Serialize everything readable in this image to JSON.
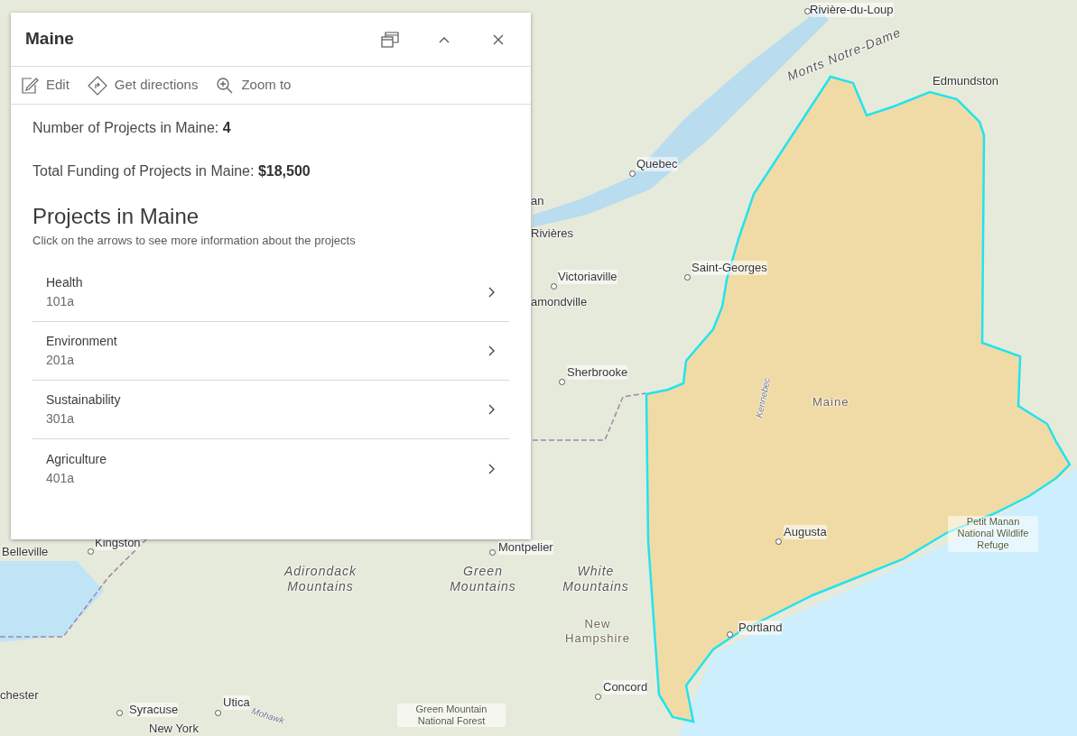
{
  "popup": {
    "title": "Maine",
    "actions": [
      {
        "kind": "edit",
        "label": "Edit"
      },
      {
        "kind": "directions",
        "label": "Get directions"
      },
      {
        "kind": "zoom",
        "label": "Zoom to"
      }
    ],
    "fields": [
      "Number of Projects in Maine: **4**",
      "Total Funding of Projects in Maine: **$18,500**"
    ],
    "heading": "Projects in Maine",
    "description": "Click on the arrows to see more information about the projects",
    "projects": [
      {
        "name": "Health",
        "code": "101a"
      },
      {
        "name": "Environment",
        "code": "201a"
      },
      {
        "name": "Sustainability",
        "code": "301a"
      },
      {
        "name": "Agriculture",
        "code": "401a"
      }
    ]
  },
  "map": {
    "labels": [
      {
        "text": "Rivière-du-Loup",
        "kind": "city"
      },
      {
        "text": "Monts Notre-Dame",
        "kind": "range"
      },
      {
        "text": "Edmundston",
        "kind": "place"
      },
      {
        "text": "Quebec",
        "kind": "city"
      },
      {
        "text": "an",
        "kind": "place"
      },
      {
        "text": "Rivières",
        "kind": "place"
      },
      {
        "text": "Victoriaville",
        "kind": "city"
      },
      {
        "text": "amondville",
        "kind": "place"
      },
      {
        "text": "Saint-Georges",
        "kind": "city"
      },
      {
        "text": "Sherbrooke",
        "kind": "city"
      },
      {
        "text": "Maine",
        "kind": "state"
      },
      {
        "text": "Kennebec",
        "kind": "river"
      },
      {
        "text": "Augusta",
        "kind": "city"
      },
      {
        "text": "Petit Manan National Wildlife Refuge",
        "kind": "park"
      },
      {
        "text": "Portland",
        "kind": "city"
      },
      {
        "text": "Belleville",
        "kind": "place"
      },
      {
        "text": "Kingston",
        "kind": "city"
      },
      {
        "text": "Montpelier",
        "kind": "city"
      },
      {
        "text": "Adirondack Mountains",
        "kind": "range"
      },
      {
        "text": "Green Mountains",
        "kind": "range"
      },
      {
        "text": "White Mountains",
        "kind": "range"
      },
      {
        "text": "New Hampshire",
        "kind": "state"
      },
      {
        "text": "Concord",
        "kind": "city"
      },
      {
        "text": "Green Mountain National Forest",
        "kind": "park"
      },
      {
        "text": "chester",
        "kind": "place"
      },
      {
        "text": "Syracuse",
        "kind": "city"
      },
      {
        "text": "Utica",
        "kind": "city"
      },
      {
        "text": "Mohawk",
        "kind": "river"
      },
      {
        "text": "New York",
        "kind": "place"
      }
    ]
  }
}
